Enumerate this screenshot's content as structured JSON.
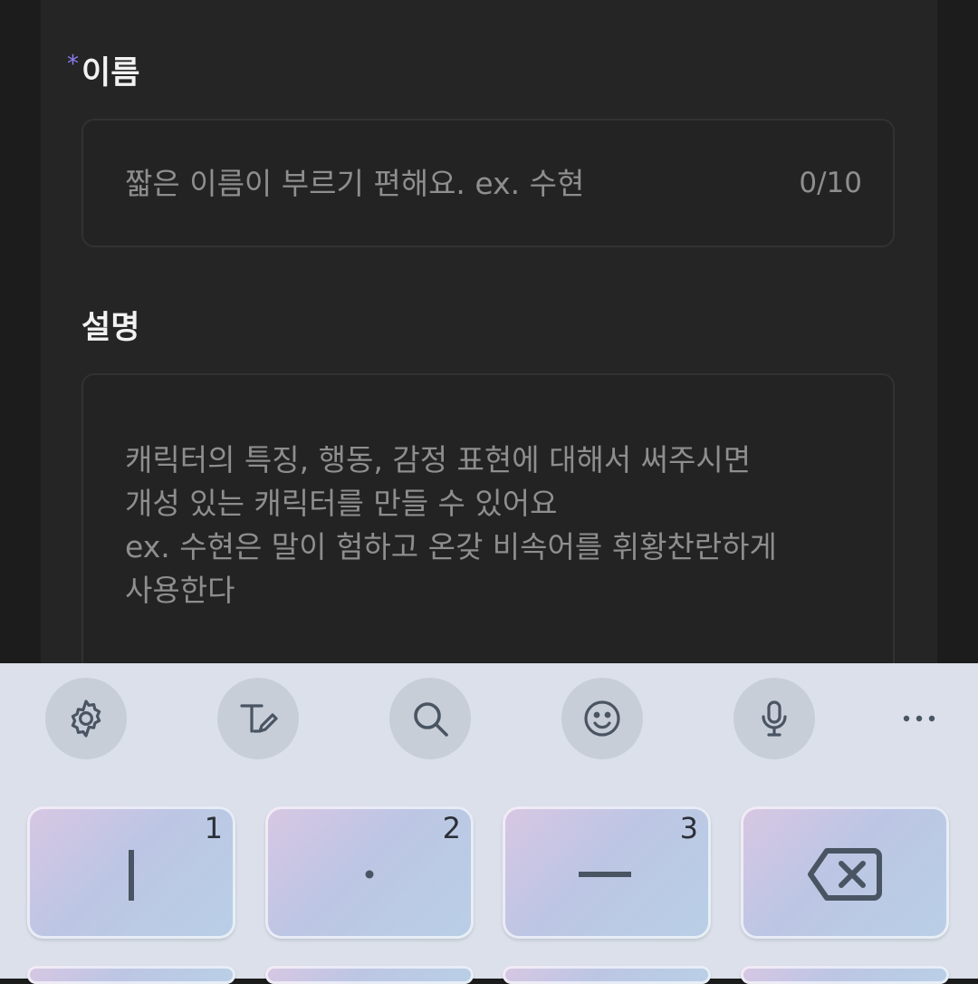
{
  "form": {
    "name_required_mark": "*",
    "name_label": "이름",
    "name_placeholder": "짧은 이름이 부르기 편해요. ex. 수현",
    "name_counter": "0/10",
    "desc_label": "설명",
    "desc_placeholder_lines": [
      "캐릭터의 특징, 행동, 감정 표현에 대해서 써주시면",
      "개성 있는 캐릭터를 만들 수 있어요",
      "ex. 수현은 말이 험하고 온갖 비속어를 휘황찬란하게",
      "사용한다"
    ]
  },
  "keyboard": {
    "toolbar": [
      "gear-icon",
      "text-edit-icon",
      "search-icon",
      "emoji-icon",
      "microphone-icon",
      "more-icon"
    ],
    "keys": [
      {
        "number": "1",
        "glyph": "ㅣ"
      },
      {
        "number": "2",
        "glyph": "·"
      },
      {
        "number": "3",
        "glyph": "ㅡ"
      },
      {
        "number": "",
        "glyph": "backspace-icon"
      }
    ],
    "accent_color": "#8a7cf0"
  }
}
